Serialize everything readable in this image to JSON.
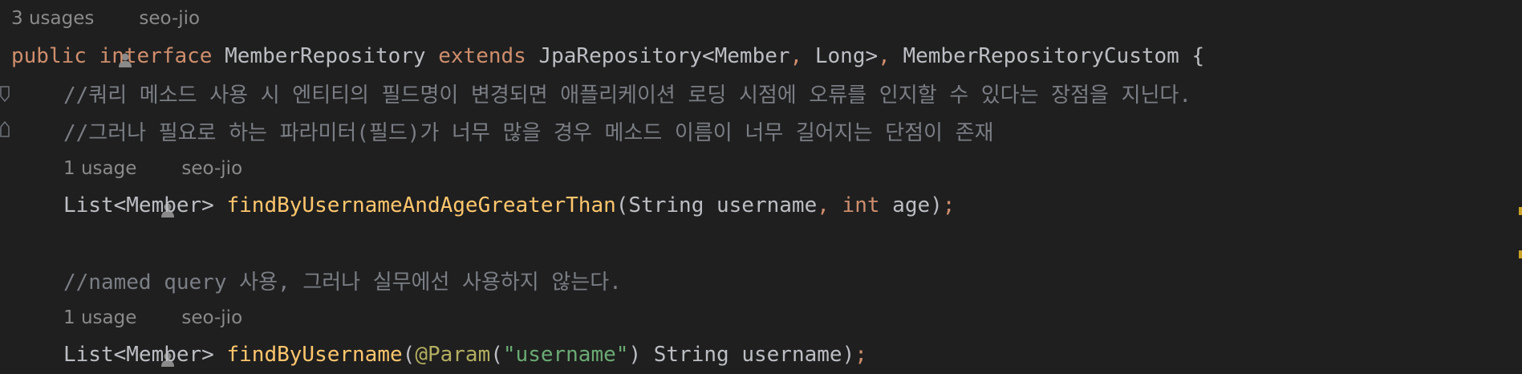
{
  "hints": {
    "interface_usages": "3 usages",
    "author": "seo-jio",
    "method1_usages": "1 usage",
    "method2_usages": "1 usage"
  },
  "code": {
    "l1": {
      "kw_public": "public",
      "kw_interface": "interface",
      "name": "MemberRepository",
      "kw_extends": "extends",
      "parent": "JpaRepository<Member",
      "comma": ",",
      "generic2": "Long>",
      "comma2": ",",
      "parent2": "MemberRepositoryCustom",
      "brace": "{"
    },
    "comment1": "//쿼리 메소드 사용 시 엔티티의 필드명이 변경되면 애플리케이션 로딩 시점에 오류를 인지할 수 있다는 장점을 지닌다.",
    "comment2": "//그러나 필요로 하는 파라미터(필드)가 너무 많을 경우 메소드 이름이 너무 길어지는 단점이 존재",
    "m1": {
      "ret": "List<Member>",
      "name": "findByUsernameAndAgeGreaterThan",
      "open": "(",
      "p1type": "String",
      "p1name": "username",
      "comma": ",",
      "p2type": "int",
      "p2name": "age",
      "close": ")",
      "semi": ";"
    },
    "comment3": "//named query 사용, 그러나 실무에선 사용하지 않는다.",
    "m2": {
      "ret": "List<Member>",
      "name": "findByUsername",
      "open": "(",
      "ann": "@Param",
      "annopen": "(",
      "str": "\"username\"",
      "annclose": ")",
      "ptype": "String",
      "pname": "username",
      "close": ")",
      "semi": ";"
    }
  },
  "colors": {
    "background": "#1f1f1f",
    "keyword": "#cf8e6d",
    "method": "#ffc66d",
    "comment": "#7a7e85",
    "string": "#6aab73",
    "annotation": "#b3ae60",
    "text": "#bcbec4",
    "hint": "#8a8a8a"
  }
}
